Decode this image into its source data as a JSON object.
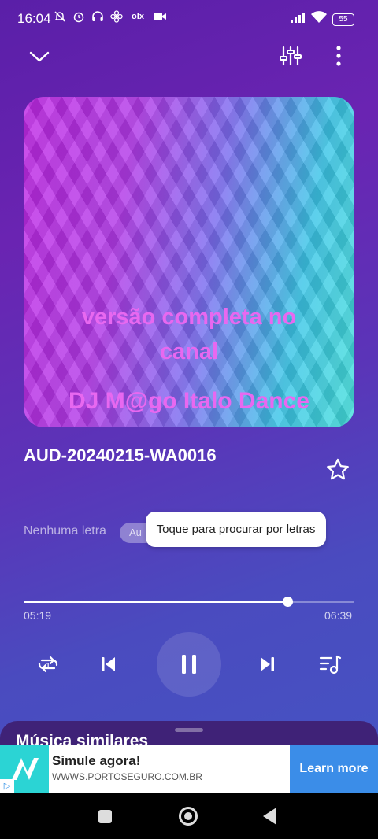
{
  "status_bar": {
    "time": "16:04",
    "battery": "55",
    "notification_icons": [
      "notifications-off-icon",
      "alarm-icon",
      "headphones-icon",
      "pinwheel-icon",
      "olx-icon",
      "video-icon"
    ],
    "olx_label": "olx"
  },
  "top_bar": {
    "collapse_icon": "chevron-down-icon",
    "equalizer_icon": "equalizer-icon",
    "menu_icon": "more-vertical-icon"
  },
  "album_art": {
    "line1": "versão completa no",
    "line2": "canal",
    "line3": "DJ M@go Italo Dance"
  },
  "track": {
    "title": "AUD-20240215-WA0016",
    "favorite_icon": "star-outline-icon"
  },
  "lyrics": {
    "no_lyrics_label": "Nenhuma letra",
    "chip_label": "Au",
    "tooltip": "Toque para procurar por letras"
  },
  "progress": {
    "current": "05:19",
    "total": "06:39",
    "fraction": 0.7995
  },
  "controls": {
    "repeat_icon": "repeat-one-icon",
    "prev_icon": "skip-previous-icon",
    "play_icon": "pause-icon",
    "next_icon": "skip-next-icon",
    "queue_icon": "queue-music-icon"
  },
  "similar": {
    "title": "Música similares"
  },
  "ad": {
    "title": "Simule agora!",
    "url": "WWWS.PORTOSEGURO.COM.BR",
    "cta": "Learn more",
    "adchoices_label": "▷"
  },
  "colors": {
    "accent_text": "#e868f0",
    "ad_button": "#3b8de8",
    "ad_logo_bg": "#2bd4d4"
  }
}
